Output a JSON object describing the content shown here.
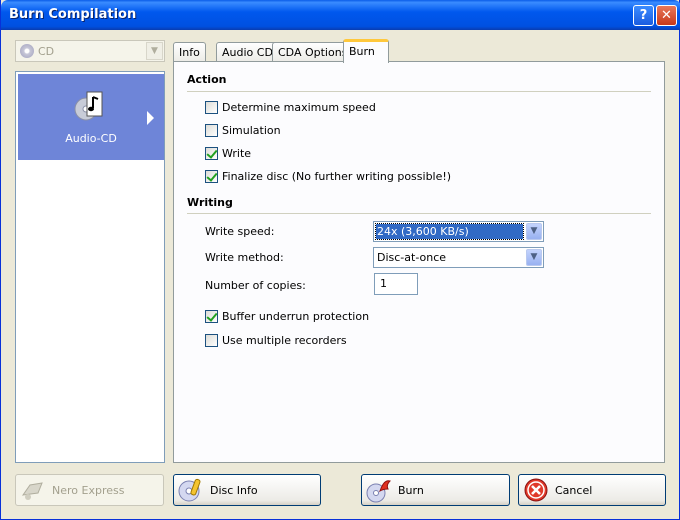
{
  "window": {
    "title": "Burn Compilation",
    "help": "?",
    "close": "✕"
  },
  "media_select": {
    "value": "CD"
  },
  "category": {
    "label": "Audio-CD"
  },
  "tabs": [
    {
      "label": "Info"
    },
    {
      "label": "Audio CD"
    },
    {
      "label": "CDA Options"
    },
    {
      "label": "Burn"
    }
  ],
  "action": {
    "title": "Action",
    "options": [
      {
        "label": "Determine maximum speed",
        "checked": false
      },
      {
        "label": "Simulation",
        "checked": false
      },
      {
        "label": "Write",
        "checked": true
      },
      {
        "label": "Finalize disc (No further writing possible!)",
        "checked": true
      }
    ]
  },
  "writing": {
    "title": "Writing",
    "speed_label": "Write speed:",
    "speed_value": "24x (3,600 KB/s)",
    "method_label": "Write method:",
    "method_value": "Disc-at-once",
    "copies_label": "Number of copies:",
    "copies_value": "1",
    "buffer_label": "Buffer underrun protection",
    "buffer_checked": true,
    "multi_label": "Use multiple recorders",
    "multi_checked": false
  },
  "buttons": {
    "nero_express": "Nero Express",
    "disc_info": "Disc Info",
    "burn": "Burn",
    "cancel": "Cancel"
  }
}
